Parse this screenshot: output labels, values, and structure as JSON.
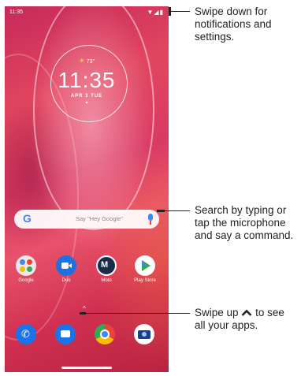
{
  "status_bar": {
    "time": "11:35",
    "icons": "▼◢▮"
  },
  "clock_widget": {
    "weather": "73°",
    "time": "11:35",
    "date": "APR 3 TUE",
    "caret": "▾"
  },
  "search_bar": {
    "logo": "G",
    "hint": "Say \"Hey Google\""
  },
  "apps": [
    {
      "label": "Google"
    },
    {
      "label": "Duo"
    },
    {
      "label": "Moto"
    },
    {
      "label": "Play Store"
    }
  ],
  "app_drawer_caret": "^",
  "dock": [
    "phone-icon",
    "messages-icon",
    "chrome-icon",
    "camera-icon"
  ],
  "callouts": {
    "notifications": [
      "Swipe down for",
      "notifications and",
      "settings."
    ],
    "search": [
      "Search by typing or",
      "tap the microphone",
      "and say a command."
    ],
    "swipe_up_prefix": "Swipe up",
    "swipe_up_suffix": "to see",
    "swipe_up_line2": "all your apps."
  }
}
